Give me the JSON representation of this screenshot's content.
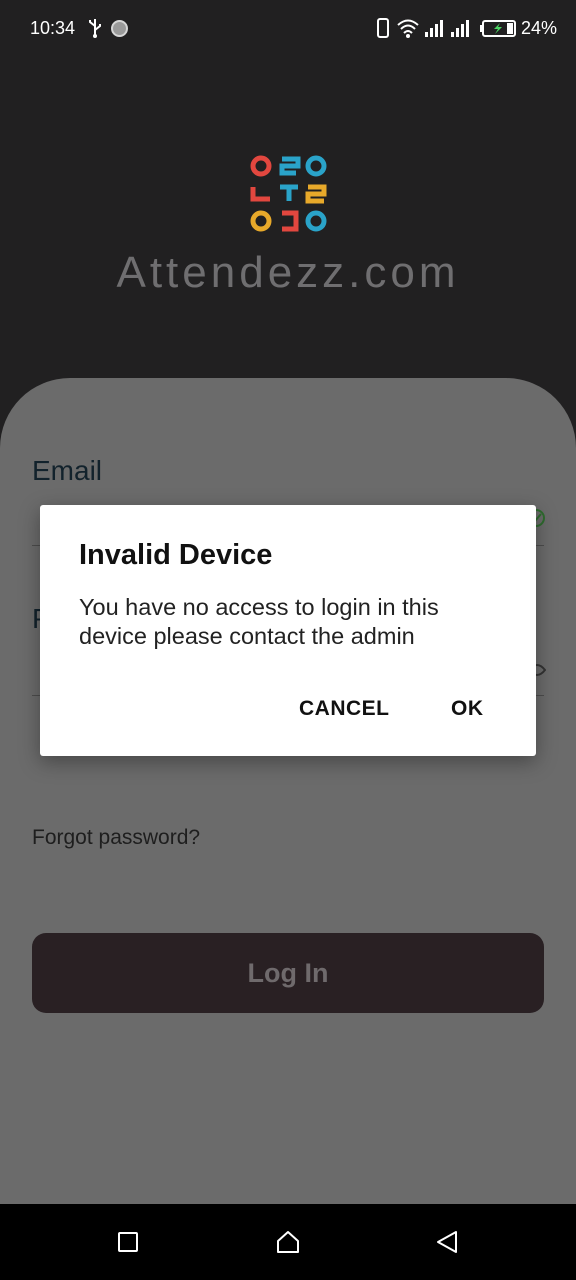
{
  "status_bar": {
    "time": "10:34",
    "battery": "24%",
    "icons": [
      "usb-icon",
      "circle-icon",
      "phone-icon",
      "wifi-icon",
      "signal-icon",
      "signal-icon",
      "battery-charging-icon"
    ]
  },
  "brand": {
    "name": "Attendezz.com",
    "logo_icon": "attendezz-logo-icon",
    "logo_colors": [
      "#e2473f",
      "#2aa3c9",
      "#e2473f",
      "#2aa3c9",
      "#e8a92a",
      "#e2473f",
      "#e8a92a",
      "#e2473f",
      "#2aa3c9"
    ]
  },
  "form": {
    "email_label": "Email",
    "password_label": "P",
    "forgot_password": "Forgot password?",
    "login_button": "Log In"
  },
  "dialog": {
    "title": "Invalid Device",
    "message": "You have no access to login in this device please contact the admin",
    "cancel": "CANCEL",
    "ok": "OK"
  },
  "nav_bar": {
    "icons": [
      "recent-apps-icon",
      "home-icon",
      "back-icon"
    ]
  },
  "colors": {
    "header_bg": "#212021",
    "overlay_bg": "#6b6b6b",
    "button_bg": "#292023"
  }
}
